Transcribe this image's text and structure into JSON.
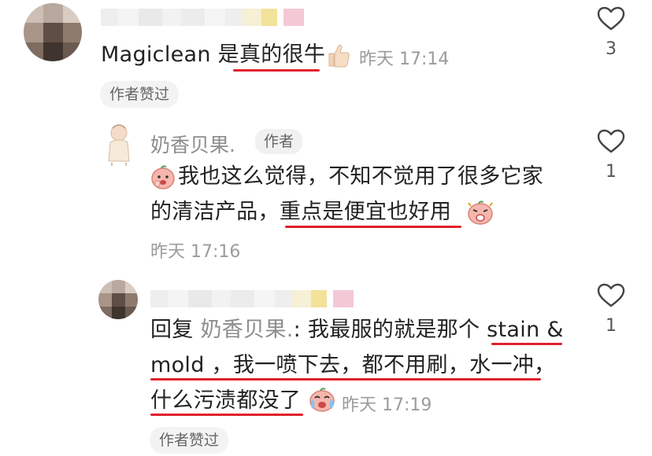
{
  "comments": [
    {
      "text_prefix": "Magiclean 是",
      "text_emph": "真的很牛",
      "timestamp": "昨天 17:14",
      "badge": "作者赞过",
      "like_count": "3"
    },
    {
      "nickname": "奶香贝果.",
      "author_tag": "作者",
      "line1": "我也这么觉得，不知不觉用了很多它家",
      "line2_prefix": "的清洁产品，",
      "line2_emph": "重点是便宜也好用",
      "timestamp": "昨天 17:16",
      "like_count": "1"
    },
    {
      "reply_prefix": "回复",
      "reply_to": "奶香贝果.",
      "reply_colon": ": ",
      "line1_prefix": "我最服的就是那个 ",
      "line1_emph": "stain &",
      "line2_emph": "mold ，我一喷下去，都不用刷，水一冲，",
      "line3_emph": "什么污渍都没了",
      "timestamp": "昨天 17:19",
      "badge": "作者赞过",
      "like_count": "1"
    }
  ],
  "colors": {
    "underline": "#e0202c",
    "muted": "#9b9b9b",
    "text": "#222222"
  },
  "icons": [
    "like-heart-icon",
    "thumbs-up-emoji",
    "peach-face-emoji",
    "angry-peach-emoji",
    "crying-peach-emoji"
  ]
}
